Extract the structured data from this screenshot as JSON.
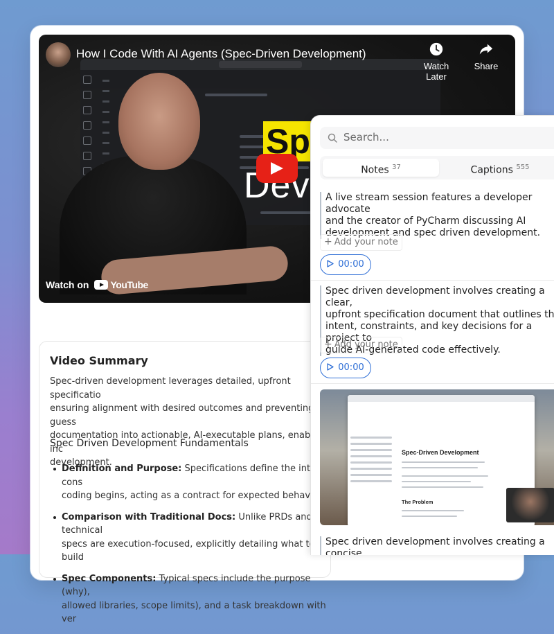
{
  "video": {
    "title": "How I Code With AI Agents (Spec-Driven Development)",
    "watch_later_label": "Watch Later",
    "share_label": "Share",
    "watch_on_label": "Watch on",
    "youtube_label": "YouTube",
    "thumbnail_spec_yellow": "Sp",
    "thumbnail_spec_white": "Dev"
  },
  "summary": {
    "title": "Video Summary",
    "paragraph": "Spec-driven development leverages detailed, upfront specificatio\nensuring alignment with desired outcomes and preventing guess\ndocumentation into actionable, AI-executable plans, enabling inc\ndevelopment.",
    "section_title": "Spec Driven Development Fundamentals",
    "bullets": [
      {
        "bold": "Definition and Purpose:",
        "text": " Specifications define the intent, cons\ncoding begins, acting as a contract for expected behavior."
      },
      {
        "bold": "Comparison with Traditional Docs:",
        "text": " Unlike PRDs and technical\nspecs are execution-focused, explicitly detailing what to build"
      },
      {
        "bold": "Spec Components:",
        "text": " Typical specs include the purpose (why),\nallowed libraries, scope limits), and a task breakdown with ver"
      }
    ]
  },
  "panel": {
    "search_placeholder": "Search...",
    "tabs": {
      "notes_label": "Notes",
      "notes_count": "37",
      "captions_label": "Captions",
      "captions_count": "555"
    },
    "notes": [
      {
        "text": "A live stream session features a developer advocate\nand the creator of PyCharm discussing AI\ndevelopment and spec driven development.",
        "add_note": "Add your note",
        "timestamp": "00:00"
      },
      {
        "text": "Spec driven development involves creating a clear,\nupfront specification document that outlines the\nintent, constraints, and key decisions for a project to\nguide AI-generated code effectively.",
        "add_note": "Add your note",
        "timestamp": "00:00"
      },
      {
        "text": "Spec driven development involves creating a concise\nupfront specification that outlines the intent, scope"
      }
    ],
    "screenshot": {
      "heading": "Spec-Driven Development",
      "heading2": "The Problem"
    }
  }
}
